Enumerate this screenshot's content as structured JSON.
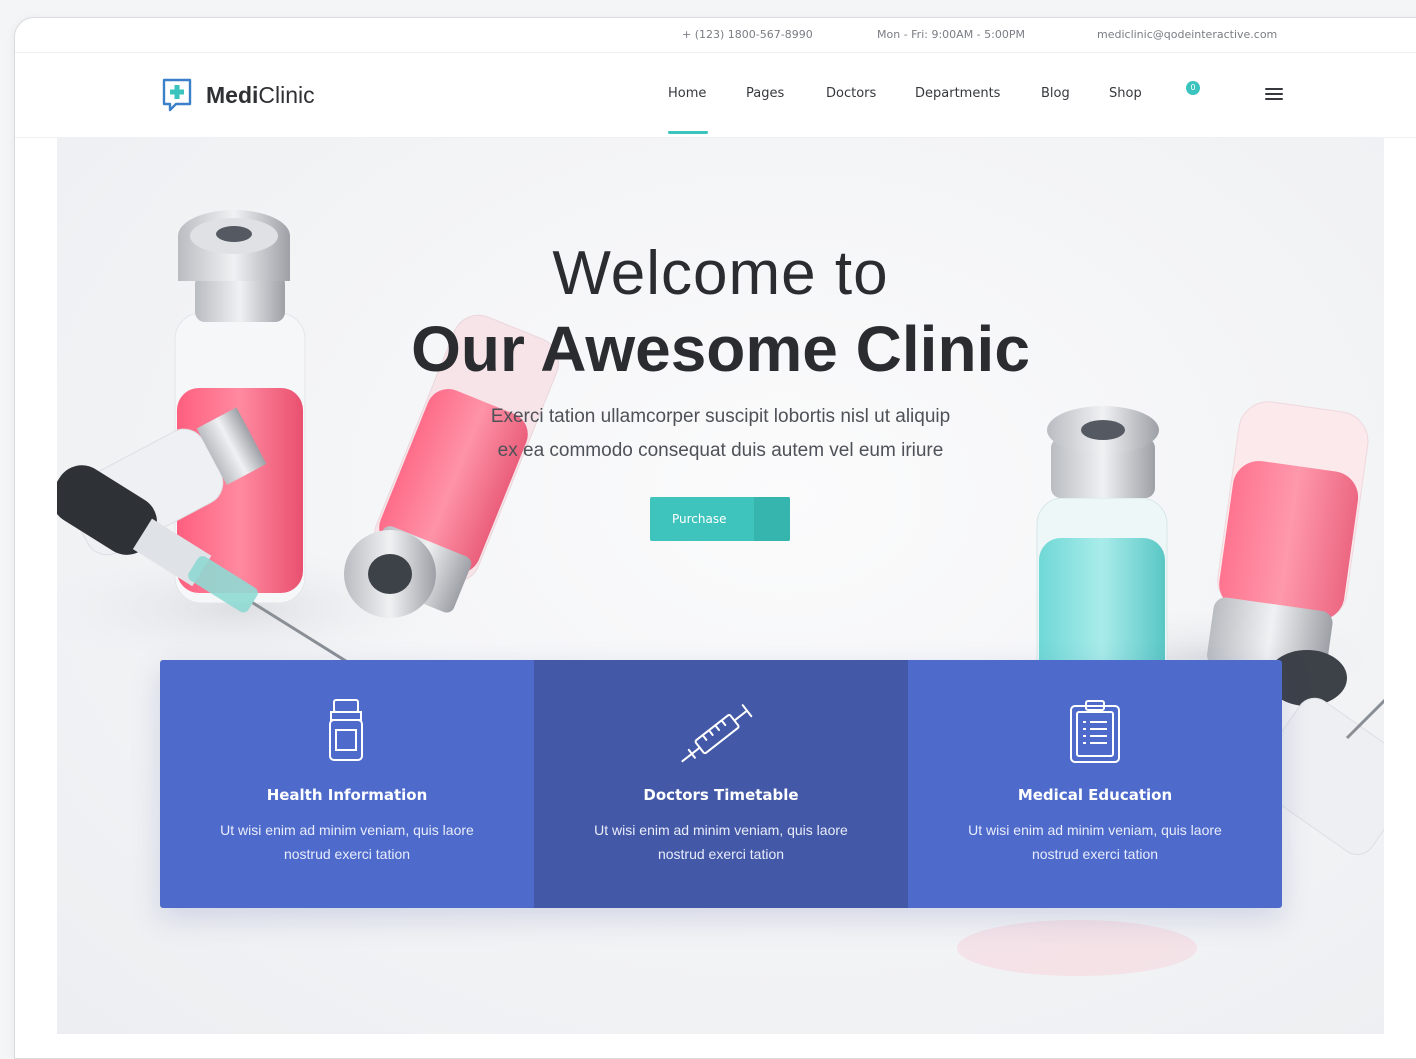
{
  "topbar": {
    "phone": "+ (123) 1800-567-8990",
    "hours": "Mon - Fri: 9:00AM - 5:00PM",
    "email": "mediclinic@qodeinteractive.com"
  },
  "brand": {
    "bold": "Medi",
    "light": "Clinic"
  },
  "nav": {
    "items": [
      "Home",
      "Pages",
      "Doctors",
      "Departments",
      "Blog",
      "Shop"
    ],
    "active": "Home",
    "cart_count": "0"
  },
  "hero": {
    "title_line1": "Welcome to",
    "title_line2": "Our Awesome Clinic",
    "text_line1": "Exerci tation ullamcorper suscipit lobortis nisl ut aliquip",
    "text_line2": "ex ea commodo consequat duis autem vel eum iriure",
    "button_label": "Purchase"
  },
  "features": [
    {
      "title": "Health Information",
      "text": "Ut wisi enim ad minim veniam, quis laore nostrud exerci tation",
      "icon": "medicine-bottle-icon"
    },
    {
      "title": "Doctors Timetable",
      "text": "Ut wisi enim ad minim veniam, quis laore nostrud exerci tation",
      "icon": "syringe-icon"
    },
    {
      "title": "Medical Education",
      "text": "Ut wisi enim ad minim veniam, quis laore nostrud exerci tation",
      "icon": "clipboard-icon"
    }
  ],
  "colors": {
    "accent": "#3ec4bd",
    "feature_blue": "#4e6bcc",
    "feature_dark": "#4358a6",
    "text_dark": "#2b2c30"
  }
}
